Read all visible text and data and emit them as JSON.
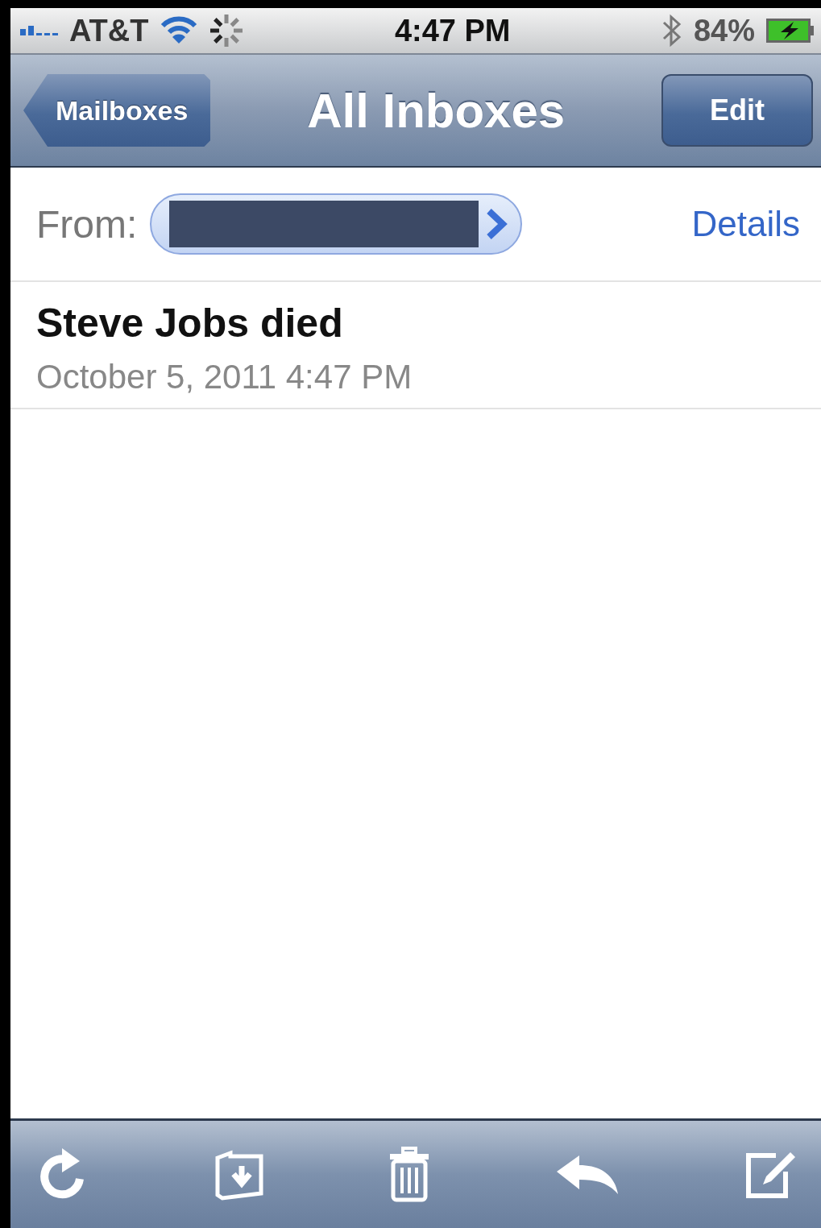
{
  "status_bar": {
    "carrier": "AT&T",
    "time": "4:47 PM",
    "battery": "84%"
  },
  "nav_bar": {
    "back_button": "Mailboxes",
    "title": "All Inboxes",
    "edit_button": "Edit"
  },
  "header": {
    "from_label": "From:",
    "sender_redacted": true,
    "details_link": "Details"
  },
  "message": {
    "subject": "Steve Jobs died",
    "date": "October 5, 2011 4:47 PM"
  }
}
